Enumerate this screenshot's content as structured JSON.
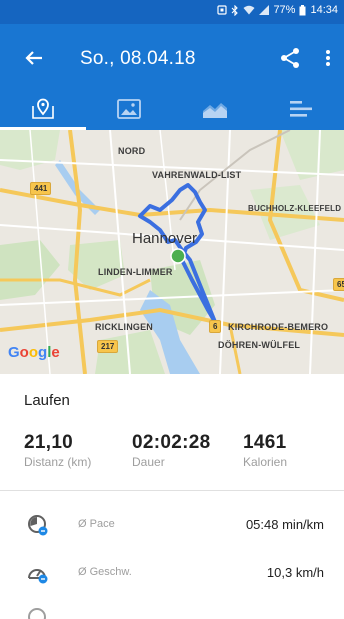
{
  "status_bar": {
    "battery": "77%",
    "time": "14:34"
  },
  "app_bar": {
    "title": "So., 08.04.18"
  },
  "tabs": [
    {
      "icon": "map-pin-icon",
      "active": true
    },
    {
      "icon": "image-icon",
      "active": false
    },
    {
      "icon": "chart-icon",
      "active": false
    },
    {
      "icon": "list-icon",
      "active": false
    }
  ],
  "map": {
    "labels": {
      "nord": "NORD",
      "vahrenwald": "VAHRENWALD-LIST",
      "buchholz": "BUCHHOLZ-KLEEFELD",
      "hannover": "Hannover",
      "linden": "LINDEN-LIMMER",
      "ricklingen": "RICKLINGEN",
      "kirchrode": "KIRCHRODE-BEMERO",
      "doehren": "DÖHREN-WÜLFEL"
    },
    "shields": {
      "r441": "441",
      "r65": "65",
      "r217": "217",
      "r6": "6"
    },
    "provider": "Google"
  },
  "activity": {
    "type": "Laufen"
  },
  "stats": [
    {
      "value": "21,10",
      "label": "Distanz (km)"
    },
    {
      "value": "02:02:28",
      "label": "Dauer"
    },
    {
      "value": "1461",
      "label": "Kalorien"
    }
  ],
  "details": [
    {
      "label": "Ø Pace",
      "value": "05:48 min/km"
    },
    {
      "label": "Ø Geschw.",
      "value": "10,3 km/h"
    }
  ],
  "colors": {
    "primary": "#1976d2",
    "status": "#1565c0",
    "route": "#3b6fe0",
    "start": "#4caf50"
  }
}
